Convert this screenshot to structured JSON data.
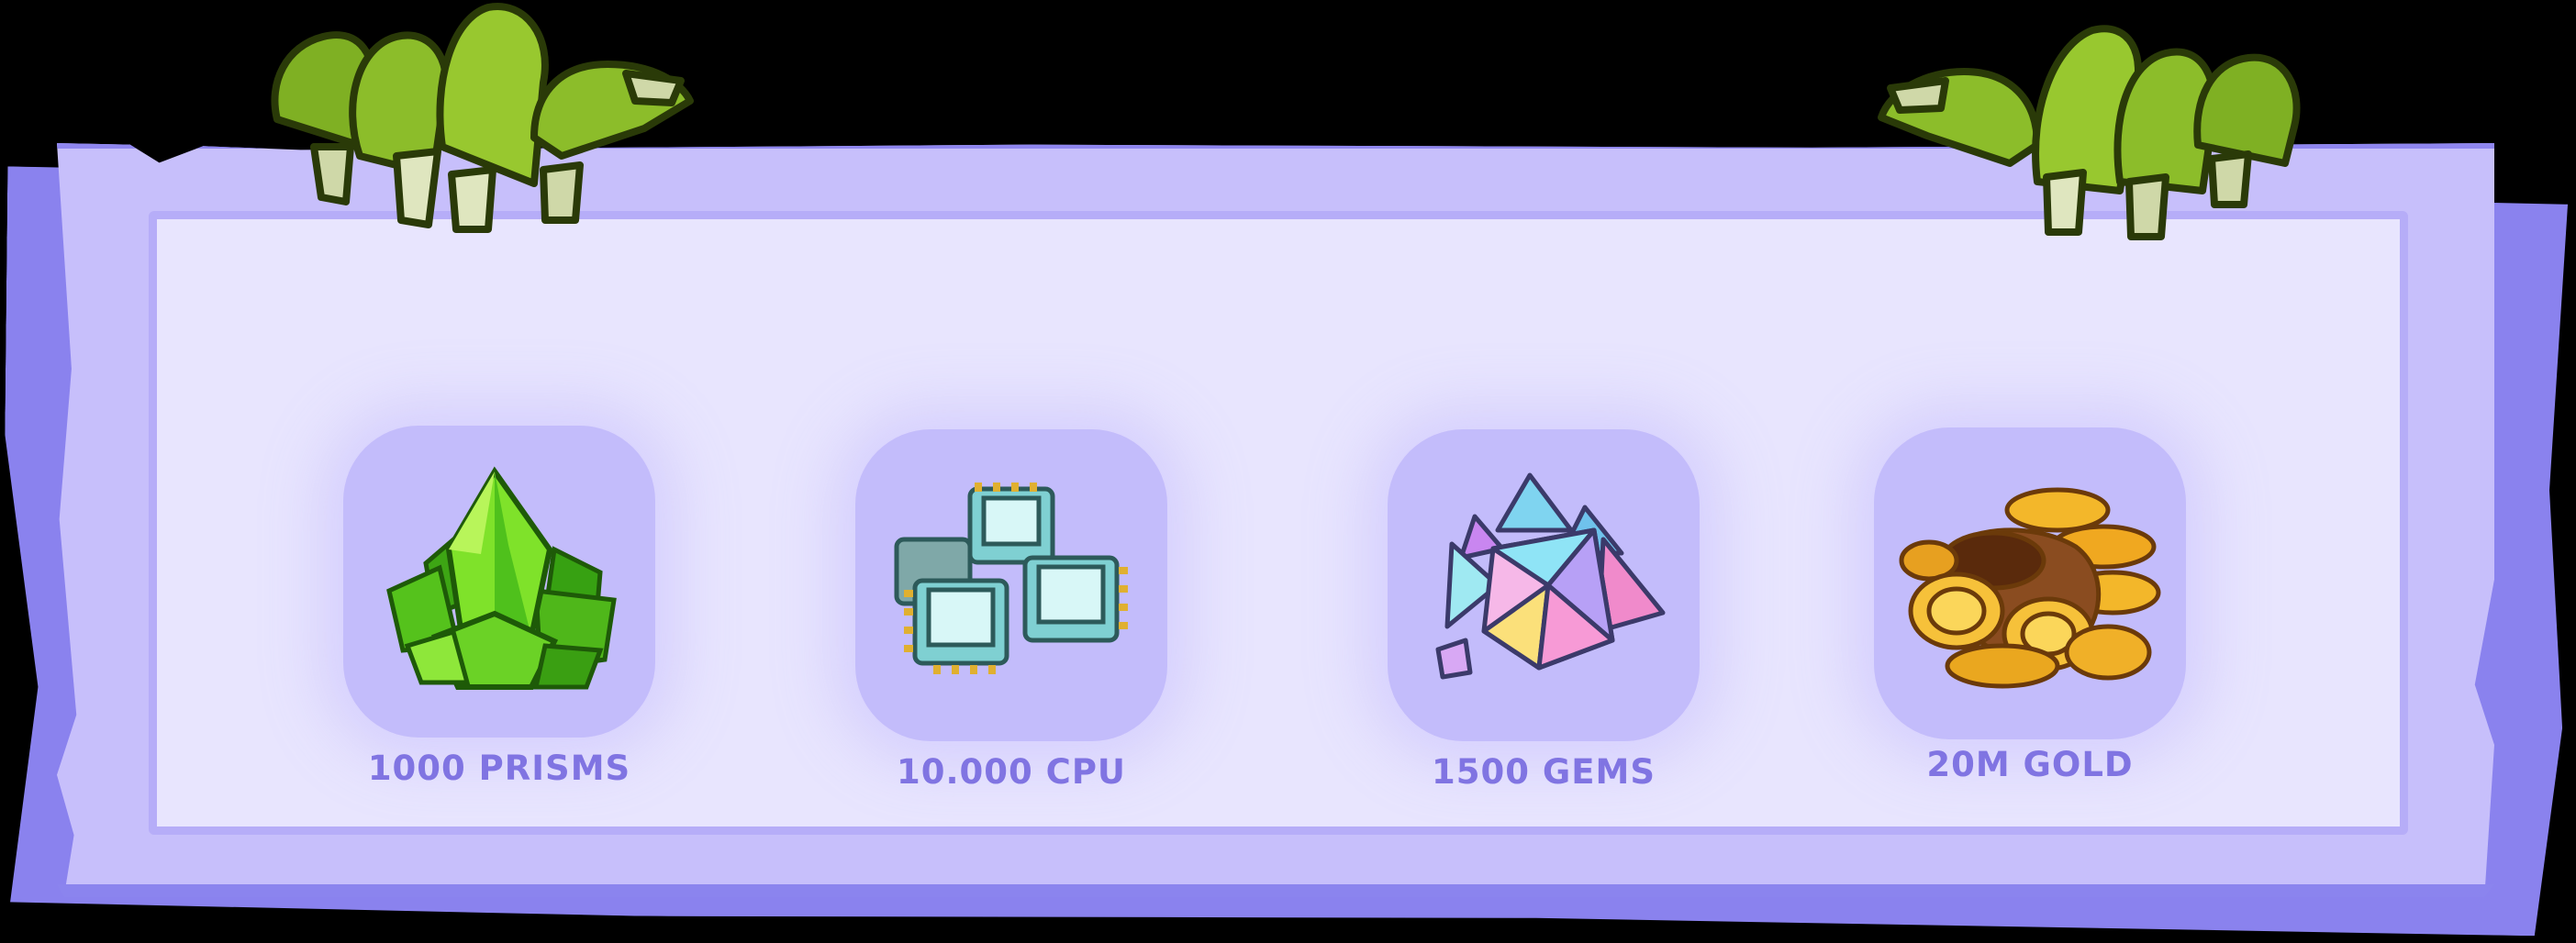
{
  "rewards": [
    {
      "label": "1000 PRISMS",
      "icon": "green-prism-crystals-icon"
    },
    {
      "label": "10.000 CPU",
      "icon": "cpu-chips-icon"
    },
    {
      "label": "1500 GEMS",
      "icon": "rainbow-gems-icon"
    },
    {
      "label": "20M GOLD",
      "icon": "gold-coins-sack-icon"
    }
  ],
  "colors": {
    "paper": "#c7bffb",
    "panel": "#e8e5fe",
    "tile": "#c3bcfb",
    "label": "#8074e2",
    "monster_hand": "#8cbd2a"
  }
}
